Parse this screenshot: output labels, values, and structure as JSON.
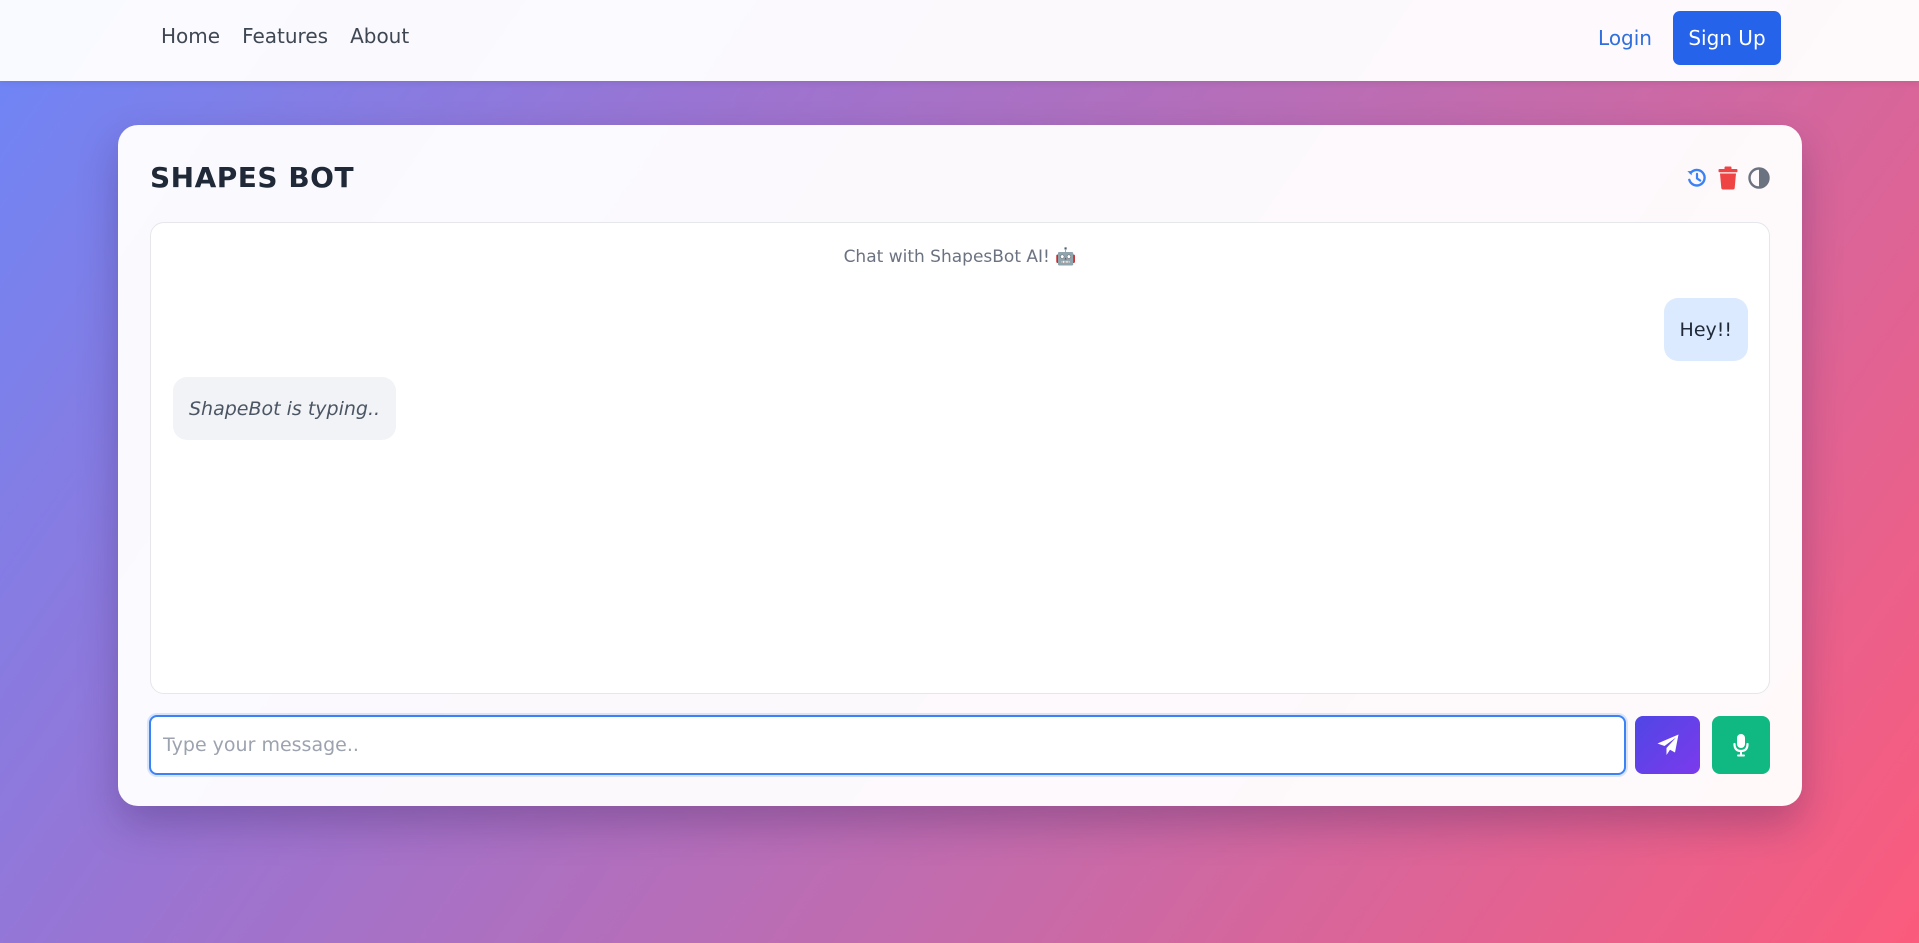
{
  "nav": {
    "links": [
      {
        "label": "Home"
      },
      {
        "label": "Features"
      },
      {
        "label": "About"
      }
    ],
    "login_label": "Login",
    "signup_label": "Sign Up"
  },
  "card": {
    "title": "SHAPES BOT",
    "tools": [
      {
        "icon": "history-icon",
        "color": "#3b82f6"
      },
      {
        "icon": "trash-icon",
        "color": "#ef4444"
      },
      {
        "icon": "contrast-icon",
        "color": "#6b7280"
      }
    ]
  },
  "chat": {
    "intro": "Chat with ShapesBot AI!",
    "intro_emoji": "🤖",
    "messages": [
      {
        "sender": "user",
        "text": "Hey!!"
      },
      {
        "sender": "bot",
        "text": "ShapeBot is typing.."
      }
    ]
  },
  "composer": {
    "placeholder": "Type your message..",
    "value": "",
    "send_icon": "paper-plane-icon",
    "mic_icon": "microphone-icon"
  },
  "colors": {
    "accent": "#2563eb",
    "send_gradient": [
      "#4f46e5",
      "#7c3aed"
    ],
    "mic": "#10b981",
    "user_bubble": "#dbeafe",
    "bot_bubble": "#f1f3f6"
  }
}
